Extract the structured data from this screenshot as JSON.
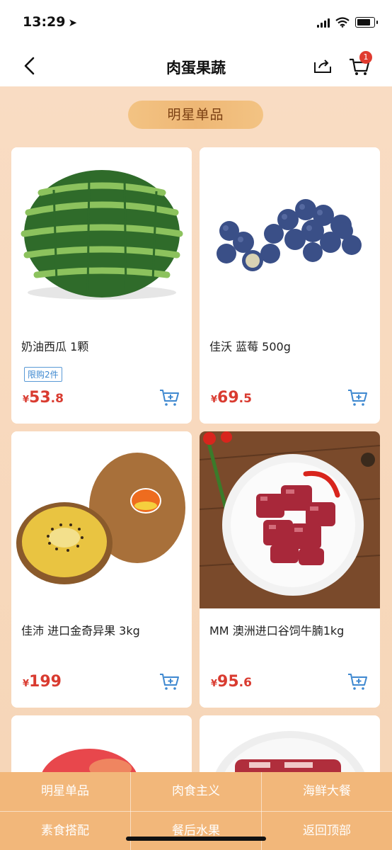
{
  "status": {
    "time": "13:29"
  },
  "navbar": {
    "title": "肉蛋果蔬",
    "cart_count": "1"
  },
  "section": {
    "title": "明星单品"
  },
  "products": [
    {
      "name": "奶油西瓜 1颗",
      "tag": "限购2件",
      "price_int": "53",
      "price_dec": ".8",
      "currency": "¥"
    },
    {
      "name": "佳沃 蓝莓 500g",
      "tag": "",
      "price_int": "69",
      "price_dec": ".5",
      "currency": "¥"
    },
    {
      "name": "佳沛 进口金奇异果 3kg",
      "tag": "",
      "price_int": "199",
      "price_dec": "",
      "currency": "¥"
    },
    {
      "name": "MM 澳洲进口谷饲牛腩1kg",
      "tag": "",
      "price_int": "95",
      "price_dec": ".6",
      "currency": "¥"
    }
  ],
  "bottom_nav": [
    {
      "label": "明星单品"
    },
    {
      "label": "肉食主义"
    },
    {
      "label": "海鲜大餐"
    },
    {
      "label": "素食搭配"
    },
    {
      "label": "餐后水果"
    },
    {
      "label": "返回顶部"
    }
  ],
  "colors": {
    "price": "#d93b30",
    "accent": "#f2b77a",
    "tag": "#3e88d0"
  },
  "icons": [
    "location-arrow-icon",
    "signal-icon",
    "wifi-icon",
    "battery-icon",
    "back-arrow-icon",
    "share-icon",
    "cart-icon",
    "add-to-cart-icon"
  ]
}
